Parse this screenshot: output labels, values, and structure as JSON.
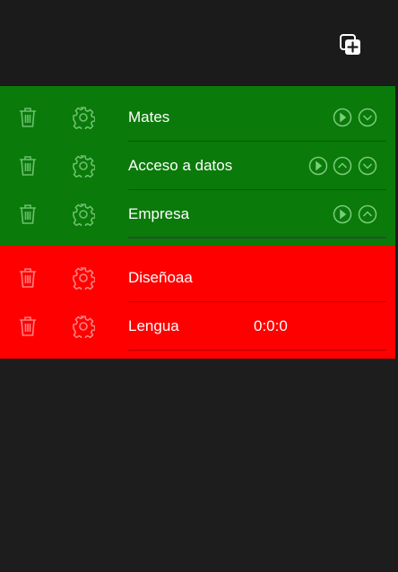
{
  "header": {
    "add_icon": "add-copy-icon"
  },
  "active_items": [
    {
      "name": "Mates",
      "controls": [
        "play-circle-icon",
        "chevron-down-circle-icon"
      ]
    },
    {
      "name": "Acceso a datos",
      "controls": [
        "play-circle-icon",
        "chevron-up-circle-icon",
        "chevron-down-circle-icon"
      ]
    },
    {
      "name": "Empresa",
      "controls": [
        "play-circle-icon",
        "chevron-up-circle-icon"
      ]
    }
  ],
  "inactive_items": [
    {
      "name": "Diseñoaa",
      "timer": ""
    },
    {
      "name": "Lengua",
      "timer": "0:0:0"
    }
  ],
  "colors": {
    "active_bg": "#0a7a0a",
    "inactive_bg": "#ff0000",
    "app_bg": "#1d1d1d"
  }
}
